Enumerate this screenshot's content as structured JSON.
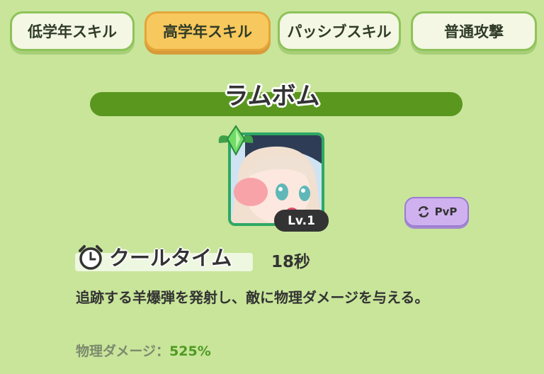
{
  "tabs": [
    {
      "label": "低学年スキル",
      "active": false
    },
    {
      "label": "高学年スキル",
      "active": true
    },
    {
      "label": "パッシブスキル",
      "active": false
    },
    {
      "label": "普通攻撃",
      "active": false
    }
  ],
  "skill": {
    "name": "ラムボム",
    "level": "Lv.1",
    "mode_badge": "PvP",
    "cooldown_label": "クールタイム",
    "cooldown_value": "18秒",
    "description": "追跡する羊爆弾を発射し、敵に物理ダメージを与える。",
    "stat_label": "物理ダメージ：",
    "stat_value": "525%"
  },
  "colors": {
    "background": "#c8e59a",
    "active_tab": "#f7c85d",
    "name_bar": "#5a971e",
    "pvp_badge": "#cfb1ef",
    "stat_value": "#4f9a22"
  },
  "icons": {
    "gem": "green-gem-icon",
    "cooldown": "alarm-clock-icon",
    "pvp": "swap-arrows-icon"
  }
}
